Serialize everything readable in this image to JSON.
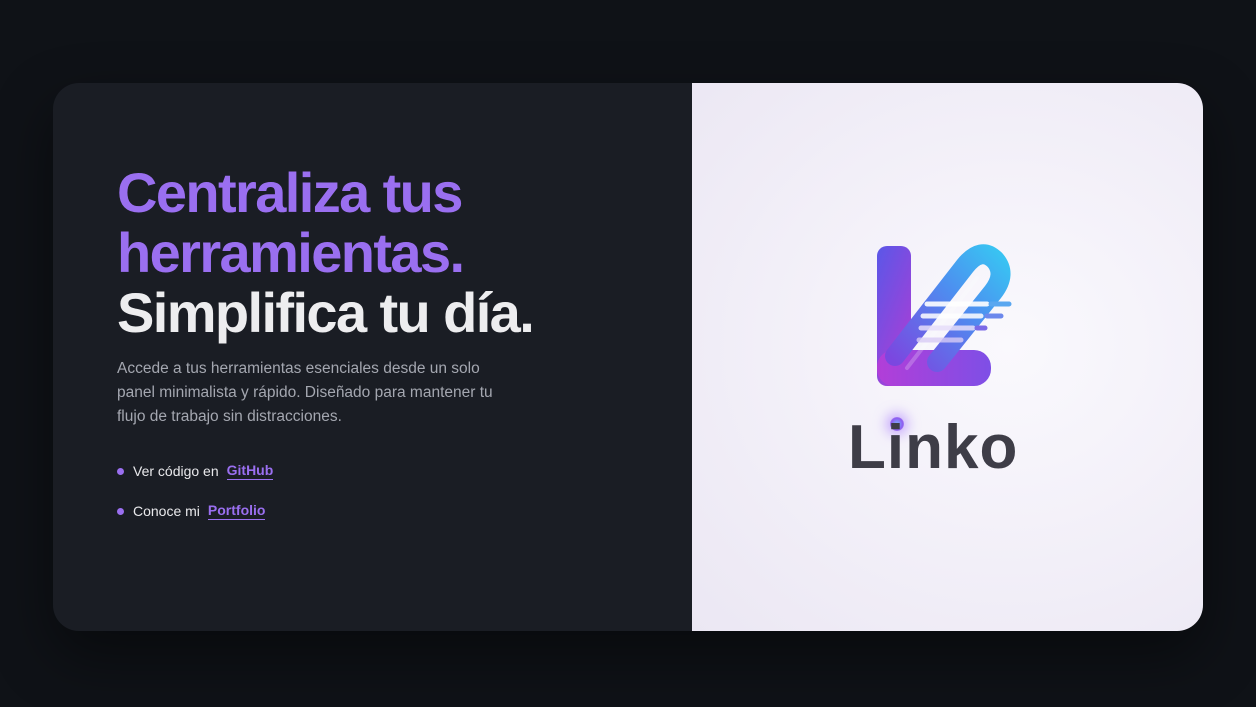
{
  "hero": {
    "headline_line1": "Centraliza tus",
    "headline_line2": "herramientas.",
    "headline_line3": "Simplifica tu día.",
    "description": "Accede a tus herramientas esenciales desde un solo panel minimalista y rápido. Diseñado para mantener tu flujo de trabajo sin distracciones."
  },
  "links": [
    {
      "prefix": "Ver código en",
      "label": "GitHub"
    },
    {
      "prefix": "Conoce mi",
      "label": "Portfolio"
    }
  ],
  "brand": {
    "name": "Linko",
    "logo_icon": "link-chain-logo-icon"
  },
  "colors": {
    "page_background": "#0f1217",
    "left_panel": "#1a1d24",
    "right_panel": "#f2eff8",
    "accent": "#9a6ff0",
    "headline_white": "#ededef",
    "body_text": "#a4a7b0",
    "wordmark": "#3e3d47"
  }
}
